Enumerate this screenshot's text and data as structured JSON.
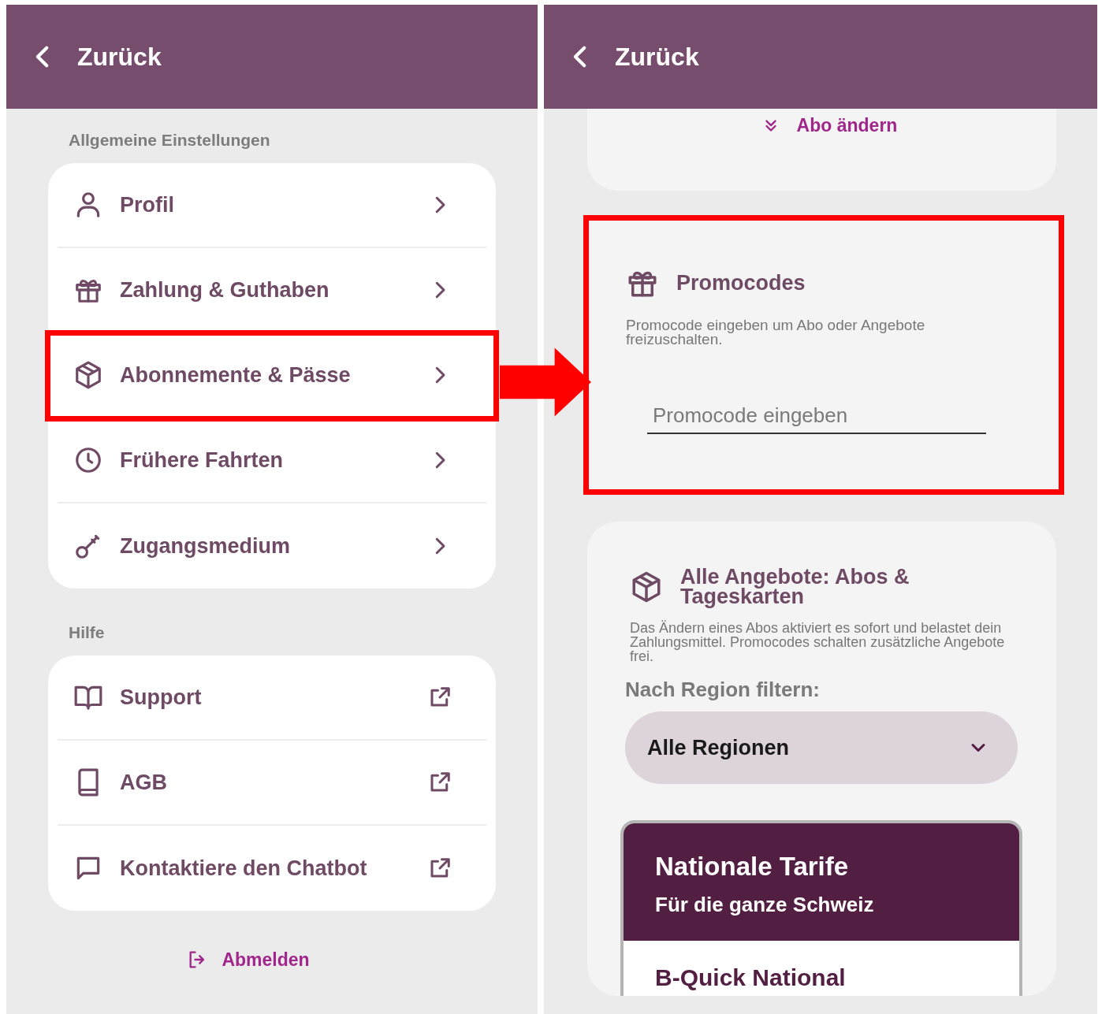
{
  "left_screen": {
    "header": {
      "back_label": "Zurück"
    },
    "sections": [
      {
        "title": "Allgemeine Einstellungen",
        "items": [
          {
            "label": "Profil",
            "kind": "page",
            "highlighted": false
          },
          {
            "label": "Zahlung & Guthaben",
            "kind": "page",
            "highlighted": false
          },
          {
            "label": "Abonnemente & Pässe",
            "kind": "page",
            "highlighted": true
          },
          {
            "label": "Frühere Fahrten",
            "kind": "page",
            "highlighted": false
          },
          {
            "label": "Zugangsmedium",
            "kind": "page",
            "highlighted": false
          }
        ]
      },
      {
        "title": "Hilfe",
        "items": [
          {
            "label": "Support",
            "kind": "external",
            "highlighted": false
          },
          {
            "label": "AGB",
            "kind": "external",
            "highlighted": false
          },
          {
            "label": "Kontaktiere den Chatbot",
            "kind": "external",
            "highlighted": false
          }
        ]
      }
    ],
    "logout": "Abmelden"
  },
  "right_screen": {
    "header": {
      "back_label": "Zurück"
    },
    "change_link": "Abo ändern",
    "promo": {
      "title": "Promocodes",
      "description": "Promocode eingeben um Abo oder Angebote freizuschalten.",
      "placeholder": "Promocode eingeben",
      "highlighted": true
    },
    "offers": {
      "title": "Alle Angebote: Abos & Tageskarten",
      "description": "Das Ändern eines Abos aktiviert es sofort und belastet dein Zahlungsmittel. Promocodes schalten zusätzliche Angebote frei.",
      "filter_label": "Nach Region filtern:",
      "filter_value": "Alle Regionen",
      "tariff_group": {
        "title": "Nationale Tarife",
        "subtitle": "Für die ganze Schweiz",
        "first_item": "B-Quick National"
      }
    }
  }
}
